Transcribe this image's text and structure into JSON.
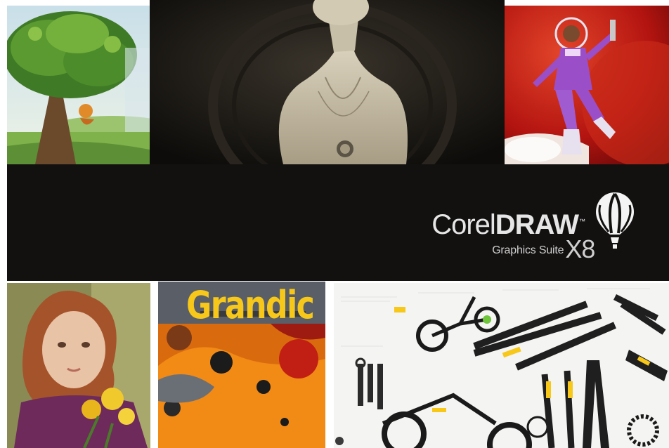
{
  "brand": {
    "prefix": "Corel",
    "name": "DRAW",
    "trademark": "™",
    "suite": "Graphics Suite",
    "version": "X8",
    "balloon_icon": "hot-air-balloon-icon"
  },
  "posters": {
    "grandic_title": "Grandic"
  },
  "colors": {
    "band": "#121110",
    "brand_text": "#e6e6e6",
    "accent_yellow": "#f7c81a",
    "orange_poster": "#f28a16",
    "space_red": "#b41410"
  }
}
